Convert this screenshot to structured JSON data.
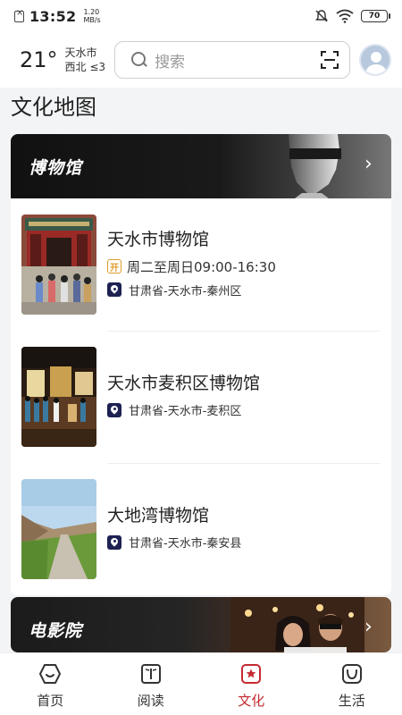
{
  "status_bar": {
    "time": "13:52",
    "net_speed_value": "1.20",
    "net_speed_unit": "MB/s",
    "battery": "70"
  },
  "header": {
    "temperature": "21°",
    "city": "天水市",
    "wind": "西北 ≤3",
    "search_placeholder": "搜索"
  },
  "section_title": "文化地图",
  "museum_category": {
    "title": "博物馆",
    "items": [
      {
        "name": "天水市博物馆",
        "hours": "周二至周日09:00-16:30",
        "open_badge": "开",
        "location": "甘肃省-天水市-秦州区"
      },
      {
        "name": "天水市麦积区博物馆",
        "location": "甘肃省-天水市-麦积区"
      },
      {
        "name": "大地湾博物馆",
        "location": "甘肃省-天水市-秦安县"
      }
    ]
  },
  "cinema_category": {
    "title": "电影院"
  },
  "tabbar": {
    "tabs": [
      {
        "label": "首页",
        "icon": "home-icon"
      },
      {
        "label": "阅读",
        "icon": "book-icon"
      },
      {
        "label": "文化",
        "icon": "culture-icon",
        "active": true
      },
      {
        "label": "生活",
        "icon": "life-icon"
      }
    ]
  },
  "colors": {
    "accent": "#c42a32",
    "location_badge": "#1d2252",
    "open_badge": "#e09a2c"
  }
}
